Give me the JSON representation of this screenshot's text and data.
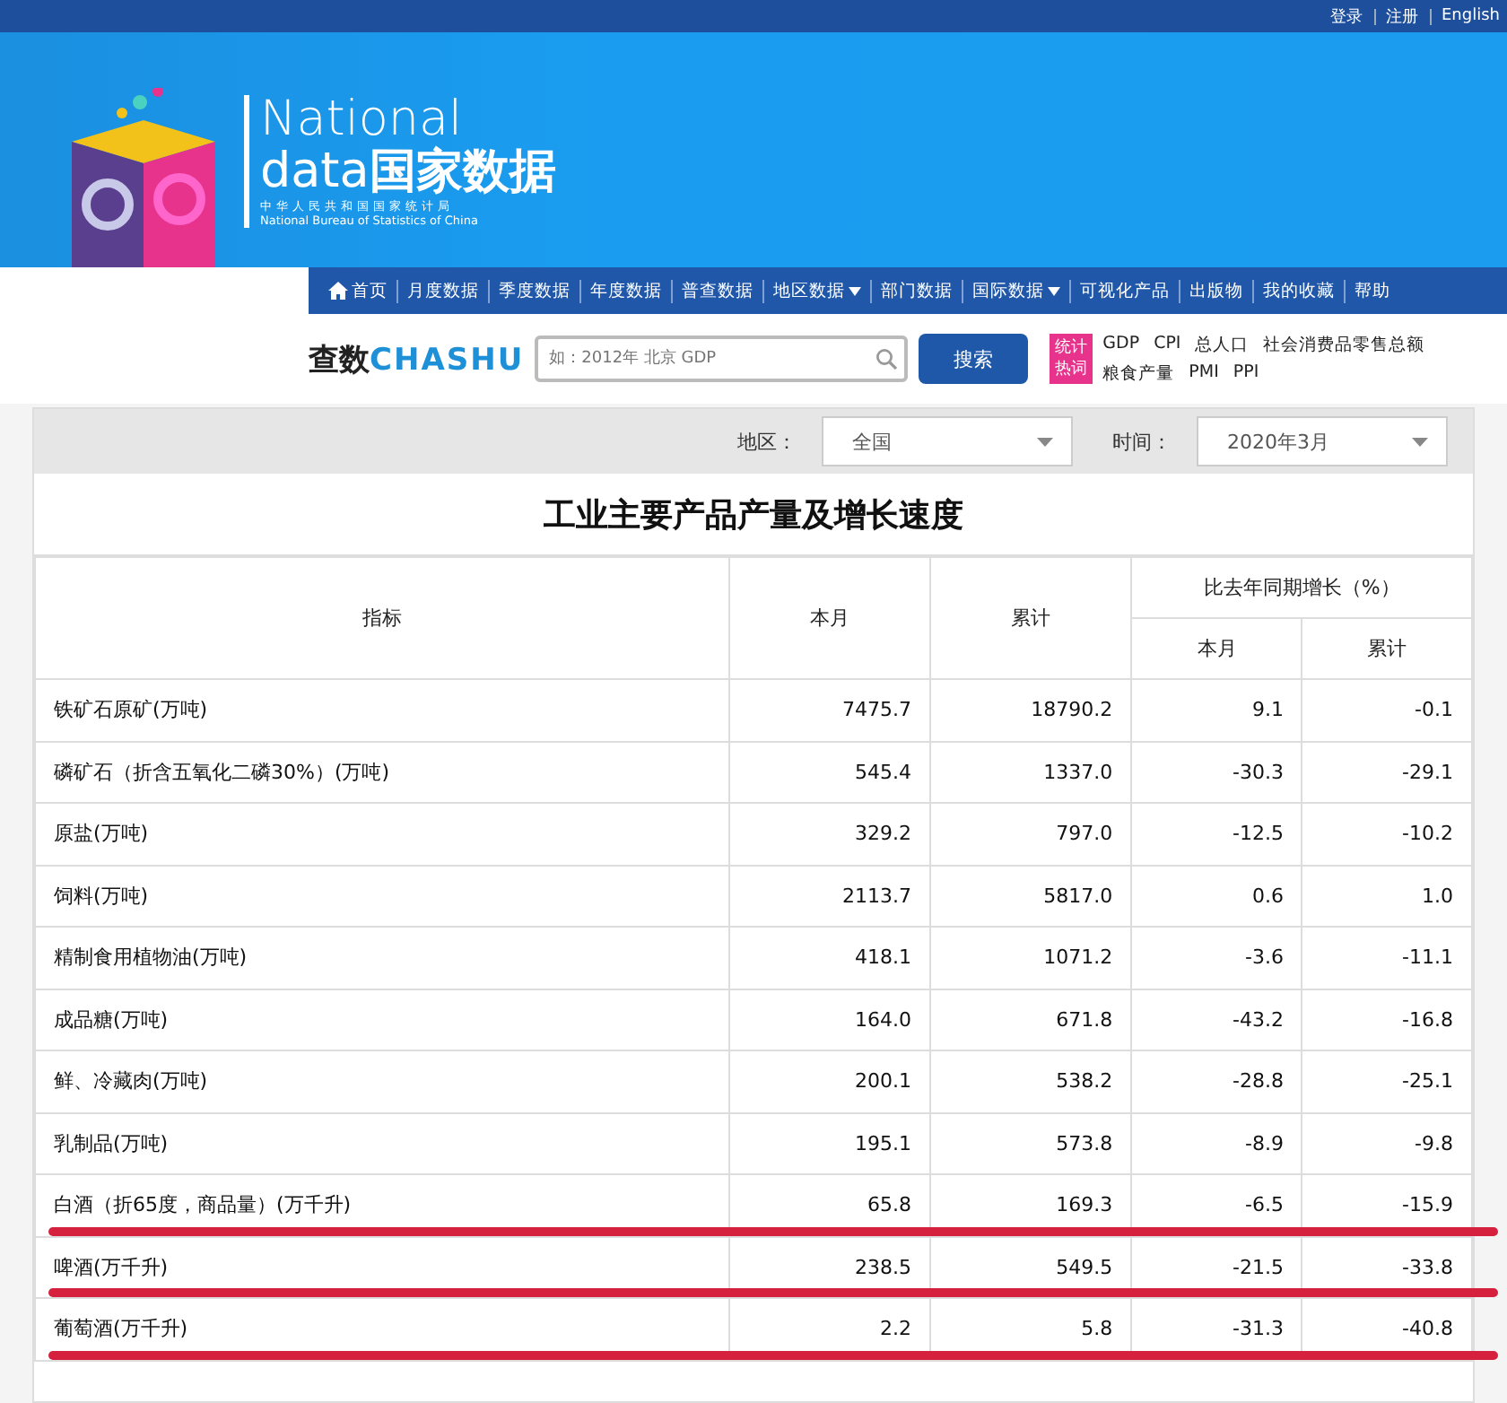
{
  "top_links": [
    "登录",
    "注册",
    "English"
  ],
  "logo": {
    "line1": "National",
    "line2_latin": "data",
    "line2_cjk": "国家数据",
    "subtitle_cn": "中华人民共和国国家统计局",
    "subtitle_en": "National Bureau of Statistics of China"
  },
  "nav": [
    {
      "label": "首页",
      "kind": "home"
    },
    {
      "label": "月度数据",
      "kind": "plain"
    },
    {
      "label": "季度数据",
      "kind": "plain"
    },
    {
      "label": "年度数据",
      "kind": "plain"
    },
    {
      "label": "普查数据",
      "kind": "plain"
    },
    {
      "label": "地区数据",
      "kind": "menu"
    },
    {
      "label": "部门数据",
      "kind": "plain"
    },
    {
      "label": "国际数据",
      "kind": "menu"
    },
    {
      "label": "可视化产品",
      "kind": "plain"
    },
    {
      "label": "出版物",
      "kind": "plain"
    },
    {
      "label": "我的收藏",
      "kind": "plain"
    },
    {
      "label": "帮助",
      "kind": "plain"
    }
  ],
  "search": {
    "brand_cjk": "查数",
    "brand_latin": "CHASHU",
    "placeholder": "如：2012年 北京 GDP",
    "button": "搜索",
    "hot_badge": "统计热词",
    "hot_words": [
      "GDP",
      "CPI",
      "总人口",
      "社会消费品零售总额",
      "粮食产量",
      "PMI",
      "PPI"
    ]
  },
  "filters": [
    {
      "label": "地区：",
      "value": "全国"
    },
    {
      "label": "时间：",
      "value": "2020年3月"
    }
  ],
  "table": {
    "title": "工业主要产品产量及增长速度",
    "columns": [
      "指标",
      "本月",
      "累计"
    ],
    "group_header": "比去年同期增长（%）",
    "sub_columns": [
      "本月",
      "累计"
    ],
    "rows": [
      {
        "cells": [
          "铁矿石原矿(万吨)",
          "7475.7",
          "18790.2",
          "9.1",
          "-0.1"
        ],
        "underlined": false
      },
      {
        "cells": [
          "磷矿石（折含五氧化二磷30%）(万吨)",
          "545.4",
          "1337.0",
          "-30.3",
          "-29.1"
        ],
        "underlined": false
      },
      {
        "cells": [
          "原盐(万吨)",
          "329.2",
          "797.0",
          "-12.5",
          "-10.2"
        ],
        "underlined": false
      },
      {
        "cells": [
          "饲料(万吨)",
          "2113.7",
          "5817.0",
          "0.6",
          "1.0"
        ],
        "underlined": false
      },
      {
        "cells": [
          "精制食用植物油(万吨)",
          "418.1",
          "1071.2",
          "-3.6",
          "-11.1"
        ],
        "underlined": false
      },
      {
        "cells": [
          "成品糖(万吨)",
          "164.0",
          "671.8",
          "-43.2",
          "-16.8"
        ],
        "underlined": false
      },
      {
        "cells": [
          "鲜、冷藏肉(万吨)",
          "200.1",
          "538.2",
          "-28.8",
          "-25.1"
        ],
        "underlined": false
      },
      {
        "cells": [
          "乳制品(万吨)",
          "195.1",
          "573.8",
          "-8.9",
          "-9.8"
        ],
        "underlined": false
      },
      {
        "cells": [
          "白酒（折65度，商品量）(万千升)",
          "65.8",
          "169.3",
          "-6.5",
          "-15.9"
        ],
        "underlined": true
      },
      {
        "cells": [
          "啤酒(万千升)",
          "238.5",
          "549.5",
          "-21.5",
          "-33.8"
        ],
        "underlined": true
      },
      {
        "cells": [
          "葡萄酒(万千升)",
          "2.2",
          "5.8",
          "-31.3",
          "-40.8"
        ],
        "underlined": true
      }
    ]
  }
}
